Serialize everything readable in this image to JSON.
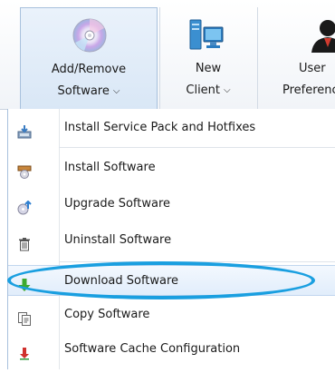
{
  "ribbon": {
    "buttons": [
      {
        "line1": "Add/Remove",
        "line2": "Software",
        "icon": "cd-disc-icon",
        "active": true
      },
      {
        "line1": "New",
        "line2": "Client",
        "icon": "computer-client-icon",
        "active": false
      },
      {
        "line1": "User",
        "line2": "Preferences",
        "icon": "user-icon",
        "active": false
      }
    ]
  },
  "menu": {
    "items": [
      {
        "label": "Install Service Pack and Hotfixes",
        "icon": "install-package-icon"
      },
      {
        "label": "Install Software",
        "icon": "install-box-icon"
      },
      {
        "label": "Upgrade Software",
        "icon": "upgrade-disc-icon"
      },
      {
        "label": "Uninstall Software",
        "icon": "trash-can-icon"
      },
      {
        "label": "Download Software",
        "icon": "download-arrow-icon",
        "highlighted": true
      },
      {
        "label": "Copy Software",
        "icon": "copy-document-icon"
      },
      {
        "label": "Software Cache Configuration",
        "icon": "cache-config-icon"
      }
    ]
  },
  "colors": {
    "highlight_ellipse": "#1a9fe0",
    "download_arrow": "#3caa2e",
    "ribbon_active": "#d9e7f6"
  }
}
